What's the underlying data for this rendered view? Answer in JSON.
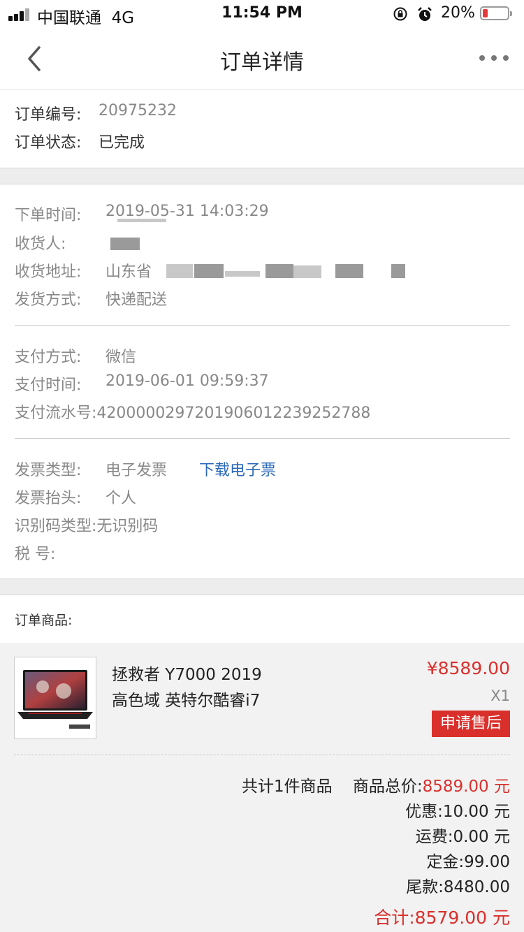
{
  "status_bar": {
    "carrier": "中国联通",
    "network": "4G",
    "time": "11:54 PM",
    "battery": "20%",
    "battery_level": 0.2,
    "icons": [
      "signal-icon",
      "rotation-lock-icon",
      "alarm-icon",
      "battery-icon"
    ]
  },
  "nav": {
    "title": "订单详情",
    "back_icon": "chevron-left-icon",
    "more_icon": "more-dots-icon"
  },
  "order": {
    "number_label": "订单编号:",
    "number": "20975232",
    "status_label": "订单状态:",
    "status": "已完成"
  },
  "delivery": {
    "order_time_label": "下单时间:",
    "order_time": "2019-05-31 14:03:29",
    "receiver_label": "收货人:",
    "address_label": "收货地址:",
    "address_visible": "山东省",
    "method_label": "发货方式:",
    "method": "快递配送"
  },
  "payment": {
    "method_label": "支付方式:",
    "method": "微信",
    "time_label": "支付时间:",
    "time": "2019-06-01 09:59:37",
    "serial_label": "支付流水号",
    "serial": ":4200000297201906012239252788"
  },
  "invoice": {
    "type_label": "发票类型:",
    "type": "电子发票",
    "download_link": "下载电子票",
    "title_label": "发票抬头:",
    "title": "个人",
    "id_type_label": "识别码类型",
    "id_type": ":无识别码",
    "tax_label": "税 号:"
  },
  "products": {
    "section_label": "订单商品:",
    "items": [
      {
        "name_line1": "拯救者 Y7000 2019",
        "name_line2": "高色域 英特尔酷睿i7",
        "price": "¥8589.00",
        "qty": "X1",
        "aftersale_button": "申请售后"
      }
    ]
  },
  "summary": {
    "count_text": "共计1件商品",
    "goods_total_label": "商品总价:",
    "goods_total": "8589.00 元",
    "discount_label": "优惠:",
    "discount": "10.00 元",
    "shipping_label": "运费:",
    "shipping": "0.00 元",
    "deposit_label": "定金:",
    "deposit": "99.00",
    "balance_label": "尾款:",
    "balance": "8480.00",
    "total_label": "合计:",
    "total": "8579.00 元"
  },
  "colors": {
    "accent_red": "#d9302c",
    "link_blue": "#2a68b8",
    "label_gray": "#888888",
    "band_gray": "#ededed"
  }
}
